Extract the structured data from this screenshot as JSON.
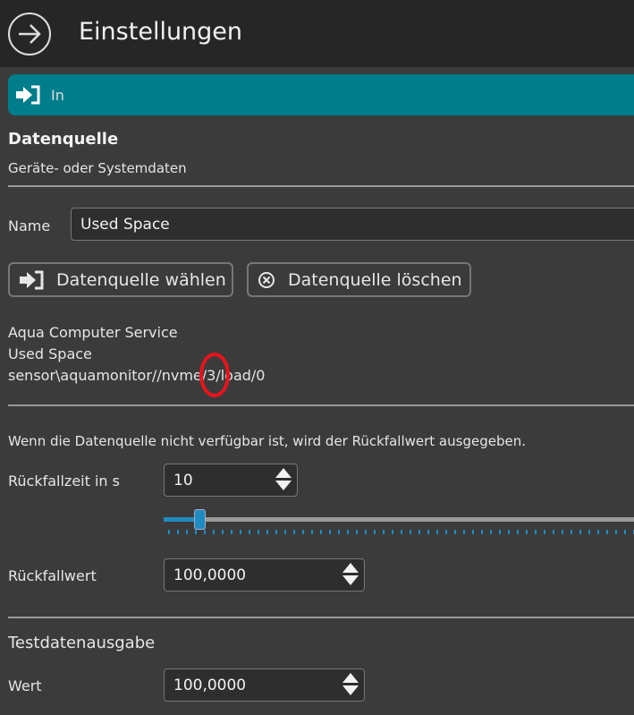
{
  "header": {
    "title": "Einstellungen"
  },
  "tab": {
    "label": "In"
  },
  "source": {
    "heading": "Datenquelle",
    "subtitle": "Geräte- oder Systemdaten",
    "name_label": "Name",
    "name_value": "Used Space",
    "choose_label": "Datenquelle wählen",
    "delete_label": "Datenquelle löschen",
    "info": [
      "Aqua Computer Service",
      "Used Space",
      "sensor\\aquamonitor//nvme/3/load/0"
    ]
  },
  "fallback": {
    "note": "Wenn die Datenquelle nicht verfügbar ist, wird der Rückfallwert ausgegeben.",
    "time_label": "Rückfallzeit in s",
    "time_value": "10",
    "value_label": "Rückfallwert",
    "value_value": "100,0000",
    "slider_value_fraction": 0.08
  },
  "test": {
    "heading": "Testdatenausgabe",
    "value_label": "Wert",
    "value_value": "100,0000"
  },
  "colors": {
    "accent": "#007d8a",
    "slider": "#1e8cc0",
    "annotation": "#e8141c"
  }
}
